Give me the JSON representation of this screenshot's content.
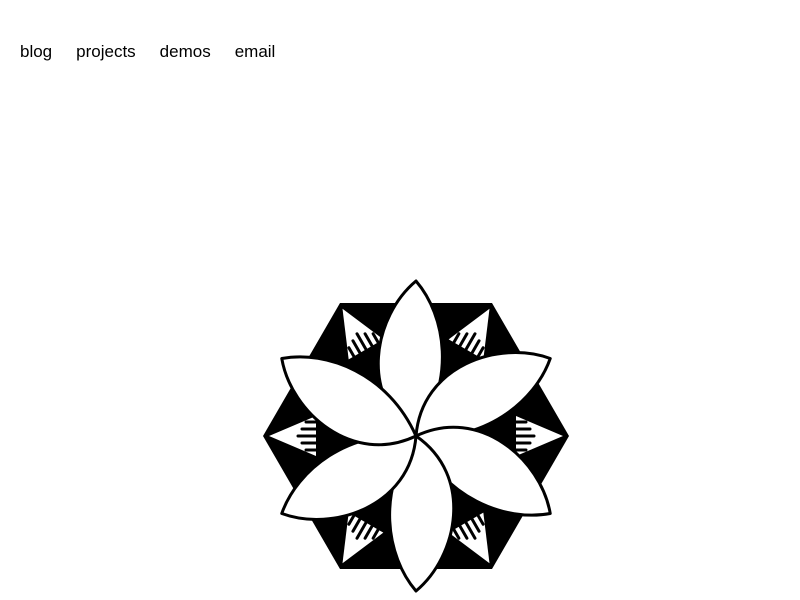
{
  "nav": {
    "items": [
      {
        "label": "blog"
      },
      {
        "label": "projects"
      },
      {
        "label": "demos"
      },
      {
        "label": "email"
      }
    ]
  },
  "logo": {
    "icon": "flower-mandala-icon",
    "stroke_color": "#000000",
    "fill_color": "#ffffff"
  }
}
